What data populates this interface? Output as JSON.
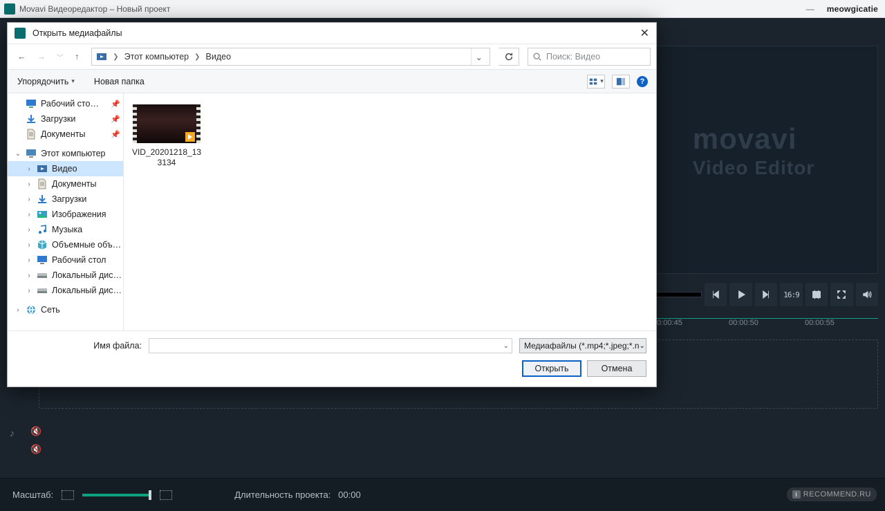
{
  "app": {
    "title": "Movavi Видеоредактор – Новый проект",
    "username": "meowgicatie"
  },
  "preview": {
    "brand": "movavi",
    "sub": "Video Editor",
    "aspect": "16:9"
  },
  "timeline": {
    "ticks": [
      "00:00:45",
      "00:00:50",
      "00:00:55"
    ]
  },
  "bottombar": {
    "zoom_label": "Масштаб:",
    "duration_label": "Длительность проекта:",
    "duration_value": "00:00"
  },
  "watermark": "RECOMMEND.RU",
  "dialog": {
    "title": "Открыть медиафайлы",
    "breadcrumb": {
      "root": "Этот компьютер",
      "leaf": "Видео"
    },
    "search_placeholder": "Поиск: Видео",
    "organize": "Упорядочить",
    "new_folder": "Новая папка",
    "sidebar": {
      "quick": [
        {
          "label": "Рабочий сто…",
          "icon": "monitor",
          "pinned": true
        },
        {
          "label": "Загрузки",
          "icon": "download",
          "pinned": true
        },
        {
          "label": "Документы",
          "icon": "doc",
          "pinned": true
        }
      ],
      "thispc_label": "Этот компьютер",
      "thispc": [
        {
          "label": "Видео",
          "icon": "video",
          "selected": true
        },
        {
          "label": "Документы",
          "icon": "doc"
        },
        {
          "label": "Загрузки",
          "icon": "download"
        },
        {
          "label": "Изображения",
          "icon": "image"
        },
        {
          "label": "Музыка",
          "icon": "music"
        },
        {
          "label": "Объемные объ…",
          "icon": "cube"
        },
        {
          "label": "Рабочий стол",
          "icon": "monitor"
        },
        {
          "label": "Локальный дис…",
          "icon": "drive"
        },
        {
          "label": "Локальный дис…",
          "icon": "drive"
        }
      ],
      "network_label": "Сеть"
    },
    "file": {
      "name_line1": "VID_20201218_13",
      "name_line2": "3134"
    },
    "footer": {
      "file_name_label": "Имя файла:",
      "file_type": "Медиафайлы (*.mp4;*.jpeg;*.n",
      "open": "Открыть",
      "cancel": "Отмена"
    }
  }
}
